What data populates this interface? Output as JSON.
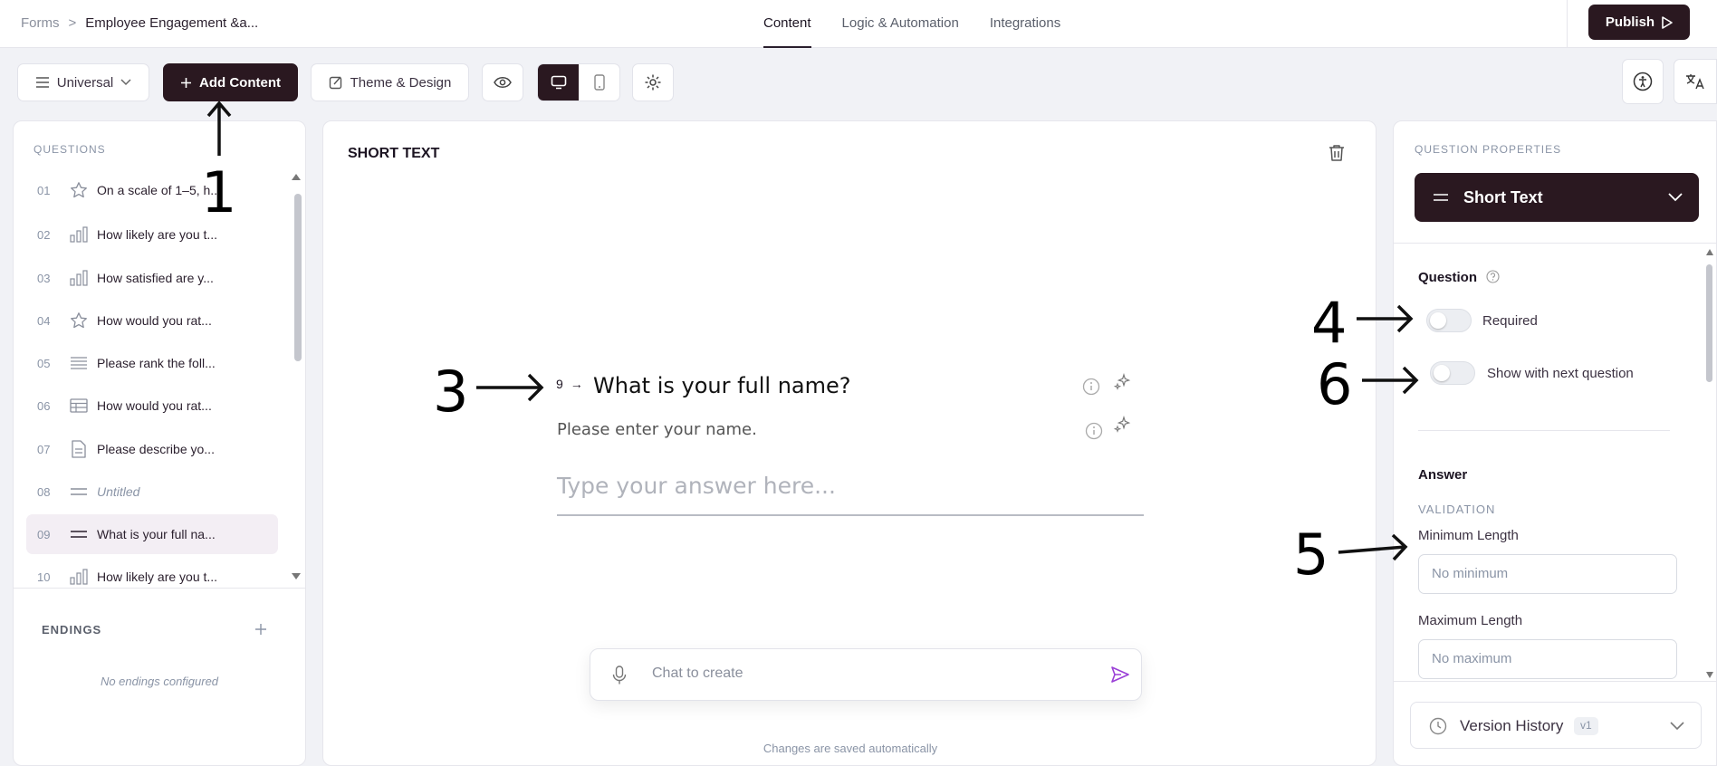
{
  "topbar": {
    "breadcrumb_root": "Forms",
    "breadcrumb_sep": ">",
    "breadcrumb_current": "Employee Engagement &a...",
    "tabs": [
      {
        "label": "Content",
        "active": true
      },
      {
        "label": "Logic & Automation",
        "active": false
      },
      {
        "label": "Integrations",
        "active": false
      }
    ],
    "publish_label": "Publish"
  },
  "toolbar": {
    "universal_label": "Universal",
    "add_content_label": "Add Content",
    "theme_label": "Theme & Design"
  },
  "questions": {
    "title": "QUESTIONS",
    "items": [
      {
        "num": "01",
        "icon": "star-icon",
        "text": "On a scale of 1–5, h..."
      },
      {
        "num": "02",
        "icon": "bar-chart-icon",
        "text": "How likely are you t..."
      },
      {
        "num": "03",
        "icon": "bar-chart-icon",
        "text": "How satisfied are y..."
      },
      {
        "num": "04",
        "icon": "star-icon",
        "text": "How would you rat..."
      },
      {
        "num": "05",
        "icon": "list-icon",
        "text": "Please rank the foll..."
      },
      {
        "num": "06",
        "icon": "table-icon",
        "text": "How would you rat..."
      },
      {
        "num": "07",
        "icon": "document-icon",
        "text": "Please describe yo..."
      },
      {
        "num": "08",
        "icon": "short-text-icon",
        "text": "Untitled"
      },
      {
        "num": "09",
        "icon": "short-text-icon",
        "text": "What is your full na..."
      },
      {
        "num": "10",
        "icon": "bar-chart-icon",
        "text": "How likely are you t..."
      }
    ]
  },
  "endings": {
    "title": "ENDINGS",
    "empty": "No endings configured"
  },
  "editor": {
    "type_label": "SHORT TEXT",
    "question_number": "9",
    "question_arrow": "→",
    "question_title": "What is your full name?",
    "question_description": "Please enter your name.",
    "answer_placeholder": "Type your answer here...",
    "chat_placeholder": "Chat to create",
    "saved_note": "Changes are saved automatically"
  },
  "properties": {
    "title": "QUESTION PROPERTIES",
    "type_select": "Short Text",
    "question_heading": "Question",
    "required_label": "Required",
    "required_on": false,
    "show_next_label": "Show with next question",
    "show_next_on": false,
    "answer_heading": "Answer",
    "validation_label": "VALIDATION",
    "min_length_label": "Minimum Length",
    "min_length_placeholder": "No minimum",
    "max_length_label": "Maximum Length",
    "max_length_placeholder": "No maximum",
    "version_label": "Version History",
    "version_badge": "v1"
  },
  "annotations": {
    "a1": "1",
    "a3": "3",
    "a4": "4",
    "a5": "5",
    "a6": "6"
  }
}
